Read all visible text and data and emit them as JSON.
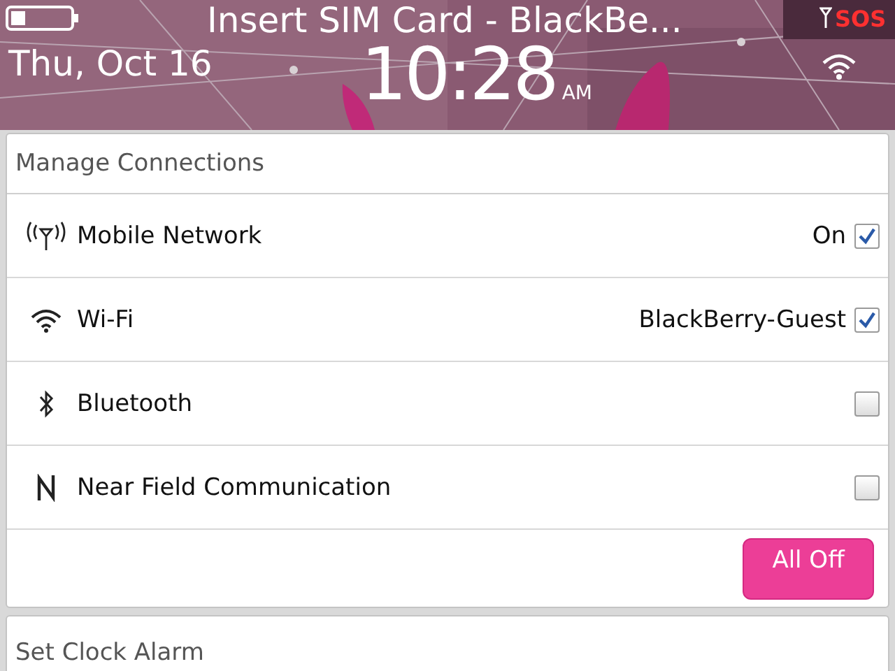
{
  "status_bar": {
    "title": "Insert SIM Card - BlackBe...",
    "date": "Thu, Oct 16",
    "time": "10:28",
    "meridiem": "AM",
    "network": "SOS"
  },
  "panel": {
    "title": "Manage Connections",
    "connections": [
      {
        "label": "Mobile Network",
        "status": "On",
        "checked": true
      },
      {
        "label": "Wi-Fi",
        "status": "BlackBerry-Guest",
        "checked": true
      },
      {
        "label": "Bluetooth",
        "checked": false
      },
      {
        "label": "Near Field Communication",
        "checked": false
      }
    ],
    "button": "All Off"
  },
  "next_item": {
    "label": "Set Clock Alarm"
  }
}
